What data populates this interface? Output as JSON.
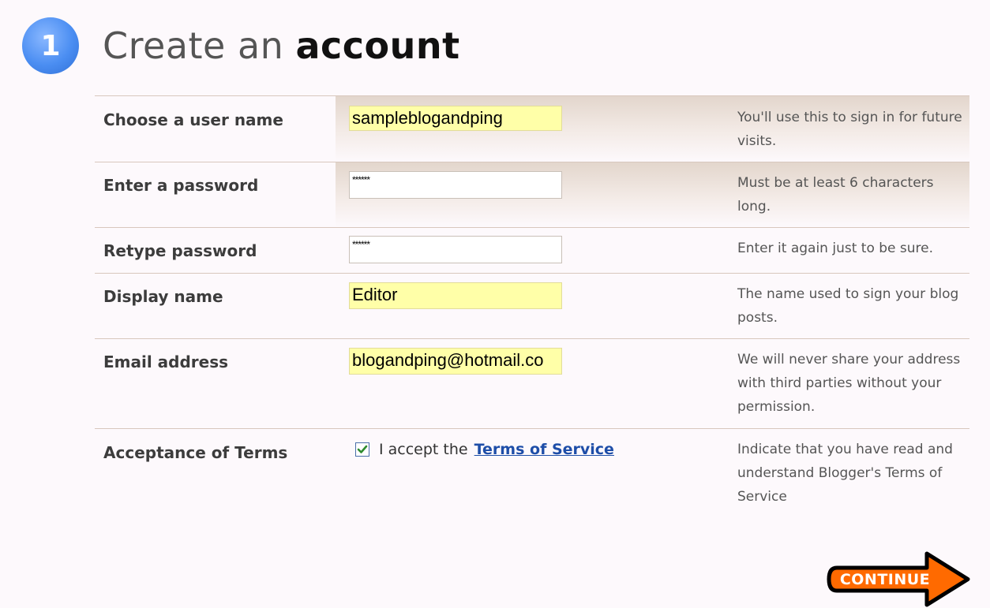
{
  "header": {
    "step_number": "1",
    "title_prefix": "Create an",
    "title_emphasis": "account"
  },
  "form": {
    "rows": [
      {
        "label": "Choose a user name",
        "value": "sampleblogandping",
        "hint": "You'll use this to sign in for future visits."
      },
      {
        "label": "Enter a password",
        "value": "******",
        "hint": "Must be at least 6 characters long."
      },
      {
        "label": "Retype password",
        "value": "******",
        "hint": "Enter it again just to be sure."
      },
      {
        "label": "Display name",
        "value": "Editor",
        "hint": "The name used to sign your blog posts."
      },
      {
        "label": "Email address",
        "value": "blogandping@hotmail.co",
        "hint": "We will never share your address with third parties without your permission."
      }
    ],
    "terms": {
      "label": "Acceptance of Terms",
      "checkbox_checked": true,
      "accept_text": "I accept the",
      "link_text": "Terms of Service",
      "hint": "Indicate that you have read and understand Blogger's Terms of Service"
    }
  },
  "continue_button": {
    "label": "CONTINUE"
  },
  "colors": {
    "step_circle": "#4b8ef2",
    "field_highlight": "#ffffa8",
    "link": "#1e4ea8",
    "continue_fill": "#ff6a00",
    "checkmark": "#2e8b2e"
  },
  "icons": {
    "checkbox": "checkmark-icon",
    "continue": "arrow-right-icon"
  }
}
